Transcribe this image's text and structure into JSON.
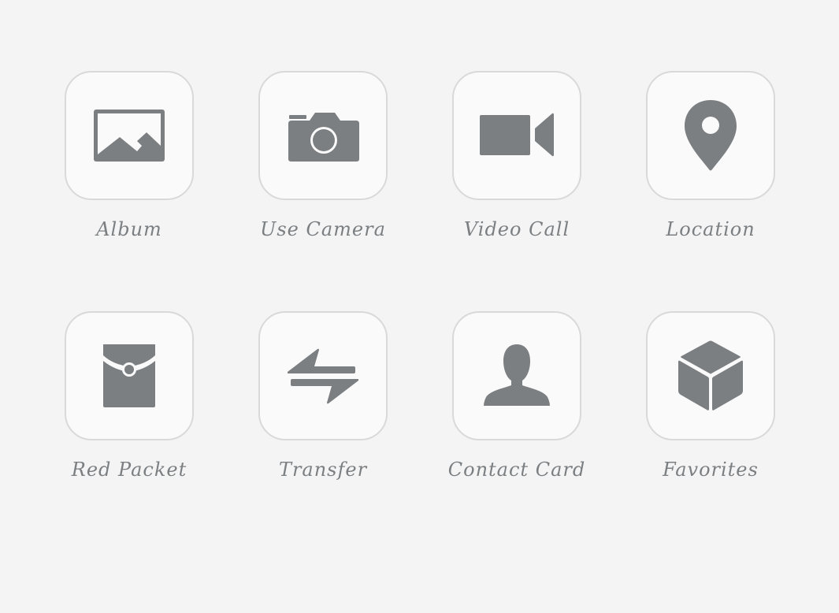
{
  "colors": {
    "background": "#f4f4f4",
    "tile_background": "#fafafa",
    "tile_border": "#d9d9d9",
    "icon": "#7b7f82",
    "label": "#7b7f82"
  },
  "actions": [
    {
      "label": "Album",
      "icon": "image-icon"
    },
    {
      "label": "Use Camera",
      "icon": "camera-icon"
    },
    {
      "label": "Video Call",
      "icon": "video-camera-icon"
    },
    {
      "label": "Location",
      "icon": "map-pin-icon"
    },
    {
      "label": "Red Packet",
      "icon": "red-packet-icon"
    },
    {
      "label": "Transfer",
      "icon": "transfer-arrows-icon"
    },
    {
      "label": "Contact Card",
      "icon": "person-icon"
    },
    {
      "label": "Favorites",
      "icon": "cube-icon"
    }
  ]
}
